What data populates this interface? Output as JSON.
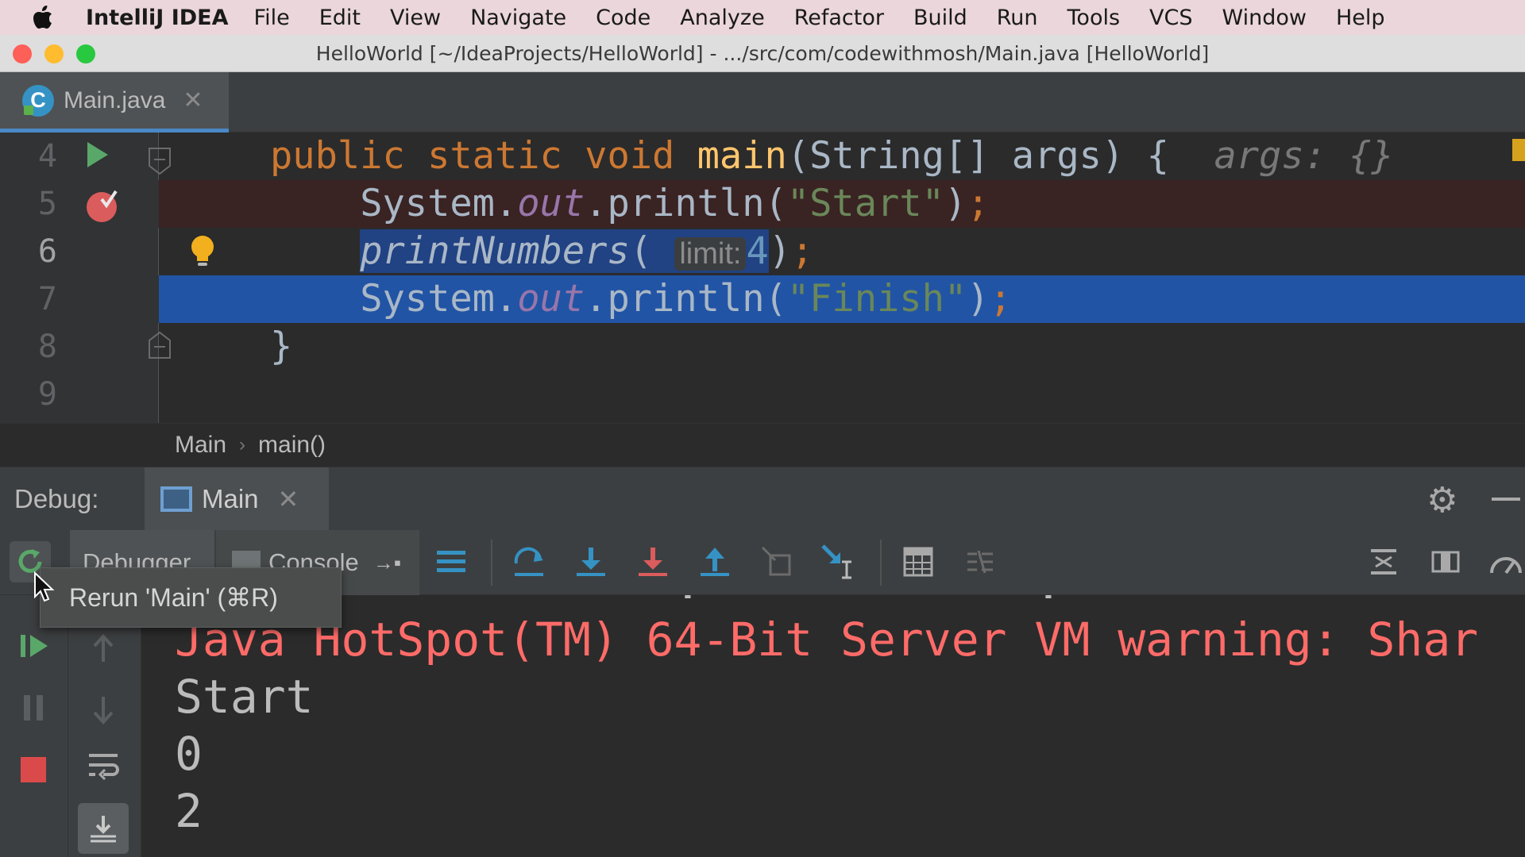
{
  "menubar": {
    "app_name": "IntelliJ IDEA",
    "items": [
      "File",
      "Edit",
      "View",
      "Navigate",
      "Code",
      "Analyze",
      "Refactor",
      "Build",
      "Run",
      "Tools",
      "VCS",
      "Window",
      "Help"
    ]
  },
  "window": {
    "title": "HelloWorld [~/IdeaProjects/HelloWorld] - .../src/com/codewithmosh/Main.java [HelloWorld]"
  },
  "editor_tabs": [
    {
      "label": "Main.java",
      "active": true
    }
  ],
  "editor": {
    "lines": [
      {
        "num": "4"
      },
      {
        "num": "5"
      },
      {
        "num": "6"
      },
      {
        "num": "7"
      },
      {
        "num": "8"
      },
      {
        "num": "9"
      }
    ],
    "tokens": {
      "l4_public": "public",
      "l4_static": "static",
      "l4_void": "void",
      "l4_main": "main",
      "l4_params": "(String[] args) {",
      "l4_hint": "args: {}",
      "l5_system": "System.",
      "l5_out": "out",
      "l5_println": ".println(",
      "l5_str": "\"Start\"",
      "l5_end": ")",
      "l5_semi": ";",
      "l6_call": "printNumbers",
      "l6_paren": "(",
      "l6_inlay": "limit:",
      "l6_arg": "4",
      "l6_close": ")",
      "l6_semi": ";",
      "l7_system": "System.",
      "l7_out": "out",
      "l7_println": ".println(",
      "l7_str": "\"Finish\"",
      "l7_end": ")",
      "l7_semi": ";",
      "l8_brace": "}"
    }
  },
  "breadcrumb": [
    "Main",
    "main()"
  ],
  "debug": {
    "title": "Debug:",
    "session_tab": "Main",
    "subtabs": [
      "Debugger",
      "Console"
    ],
    "console_lines": [
      {
        "text": "Java HotSpot(TM) 64-Bit Server VM warning: Shar",
        "type": "error"
      },
      {
        "text": "Start",
        "type": "output"
      },
      {
        "text": "0",
        "type": "output"
      },
      {
        "text": "2",
        "type": "output"
      }
    ],
    "tooltip": "Rerun 'Main' (⌘R)"
  },
  "colors": {
    "accent": "#4a88c7",
    "execution_line": "#2154a5",
    "breakpoint": "#db5c5c",
    "run_green": "#59a869",
    "error_text": "#ff6b68"
  }
}
